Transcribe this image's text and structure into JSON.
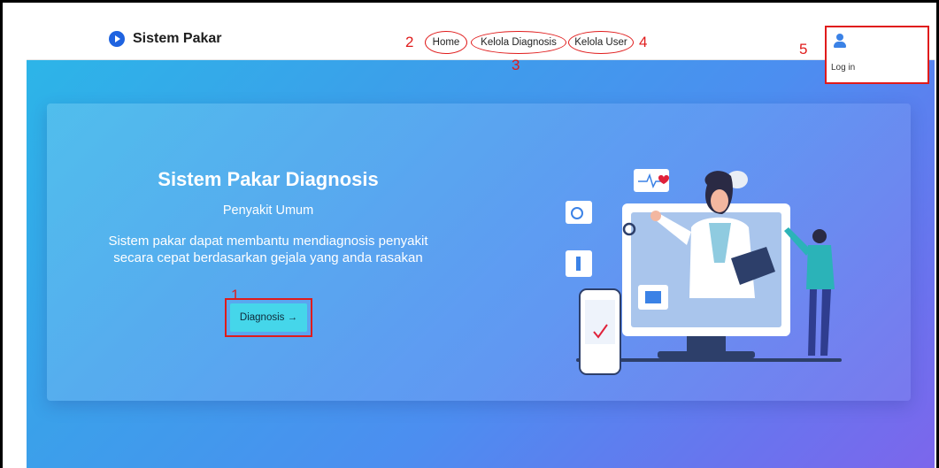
{
  "navbar": {
    "brand": "Sistem Pakar",
    "links": [
      {
        "label": "Home"
      },
      {
        "label": "Kelola Diagnosis"
      },
      {
        "label": "Kelola User"
      }
    ],
    "user_menu": {
      "login_label": "Log in"
    }
  },
  "annotations": [
    "1",
    "2",
    "3",
    "4",
    "5"
  ],
  "hero": {
    "title": "Sistem Pakar Diagnosis",
    "subtitle": "Penyakit Umum",
    "description": "Sistem pakar dapat membantu mendiagnosis penyakit secara cepat berdasarkan gejala yang anda rasakan",
    "button_label": "Diagnosis →"
  },
  "colors": {
    "brand": "#1f63e0",
    "annotation": "#e01b1b",
    "button": "#45d6ea"
  }
}
